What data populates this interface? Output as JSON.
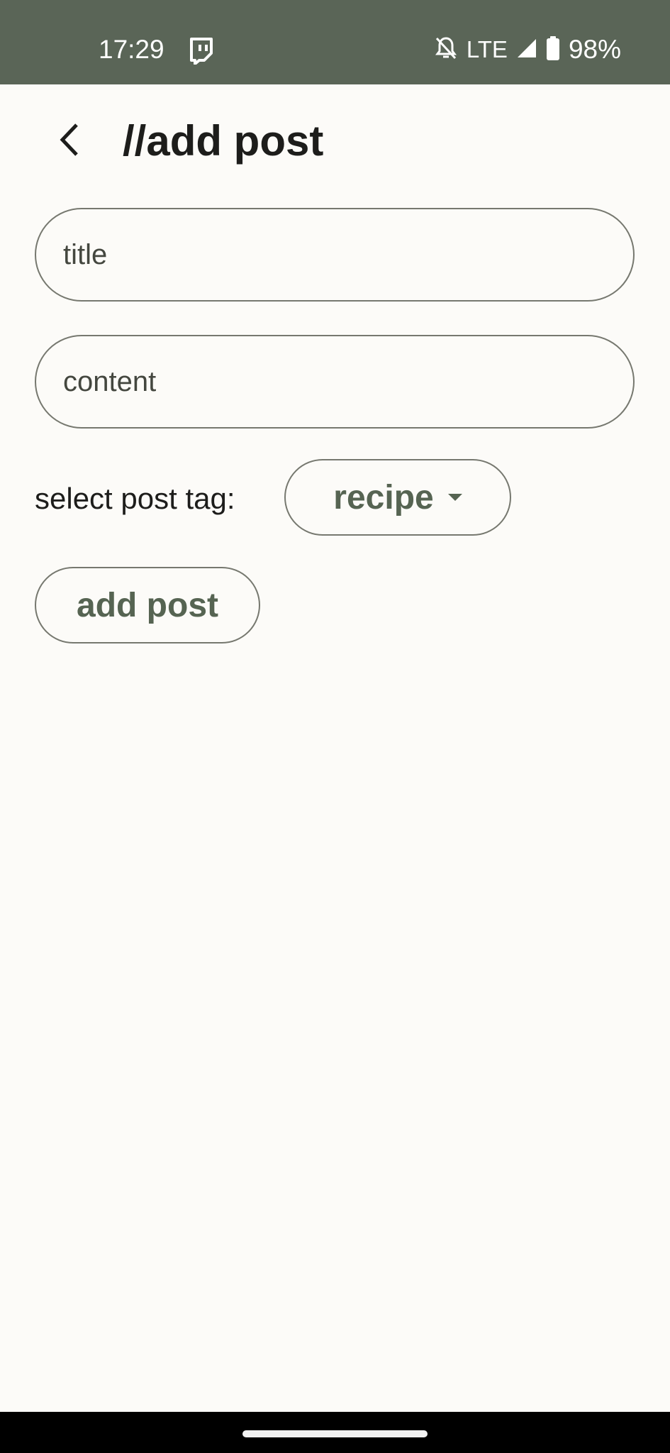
{
  "status_bar": {
    "time": "17:29",
    "network": "LTE",
    "battery": "98%",
    "icons": [
      "twitch-icon",
      "notifications-off-icon",
      "signal-icon",
      "battery-icon"
    ]
  },
  "app_bar": {
    "title": "//add post",
    "back_icon": "chevron-left-icon"
  },
  "form": {
    "title_placeholder": "title",
    "content_placeholder": "content",
    "tag_label": "select post tag:",
    "tag_value": "recipe",
    "submit_label": "add post"
  },
  "colors": {
    "status_bar_bg": "#5a6557",
    "background": "#fcfbf8",
    "accent": "#566452",
    "outline": "#76786f"
  }
}
